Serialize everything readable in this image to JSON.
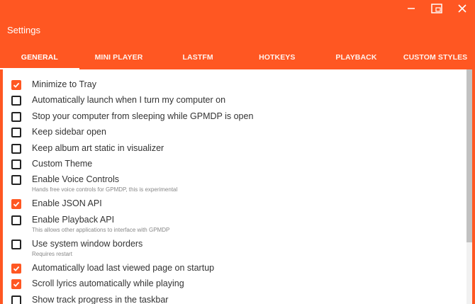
{
  "window": {
    "title": "Settings",
    "controls": [
      "minimize-icon",
      "maximize-icon",
      "close-icon"
    ]
  },
  "tabs": [
    {
      "label": "GENERAL",
      "active": true
    },
    {
      "label": "MINI PLAYER",
      "active": false
    },
    {
      "label": "LASTFM",
      "active": false
    },
    {
      "label": "HOTKEYS",
      "active": false
    },
    {
      "label": "PLAYBACK",
      "active": false
    },
    {
      "label": "CUSTOM STYLES",
      "active": false
    }
  ],
  "settings": [
    {
      "label": "Minimize to Tray",
      "checked": true,
      "sub": ""
    },
    {
      "label": "Automatically launch when I turn my computer on",
      "checked": false,
      "sub": ""
    },
    {
      "label": "Stop your computer from sleeping while GPMDP is open",
      "checked": false,
      "sub": ""
    },
    {
      "label": "Keep sidebar open",
      "checked": false,
      "sub": ""
    },
    {
      "label": "Keep album art static in visualizer",
      "checked": false,
      "sub": ""
    },
    {
      "label": "Custom Theme",
      "checked": false,
      "sub": ""
    },
    {
      "label": "Enable Voice Controls",
      "checked": false,
      "sub": "Hands free voice controls for GPMDP, this is experimental"
    },
    {
      "label": "Enable JSON API",
      "checked": true,
      "sub": ""
    },
    {
      "label": "Enable Playback API",
      "checked": false,
      "sub": "This allows other applications to interface with GPMDP"
    },
    {
      "label": "Use system window borders",
      "checked": false,
      "sub": "Requires restart"
    },
    {
      "label": "Automatically load last viewed page on startup",
      "checked": true,
      "sub": ""
    },
    {
      "label": "Scroll lyrics automatically while playing",
      "checked": true,
      "sub": ""
    },
    {
      "label": "Show track progress in the taskbar",
      "checked": false,
      "sub": ""
    }
  ],
  "colors": {
    "accent": "#ff5722",
    "text": "#333333",
    "subtext": "#888888"
  }
}
